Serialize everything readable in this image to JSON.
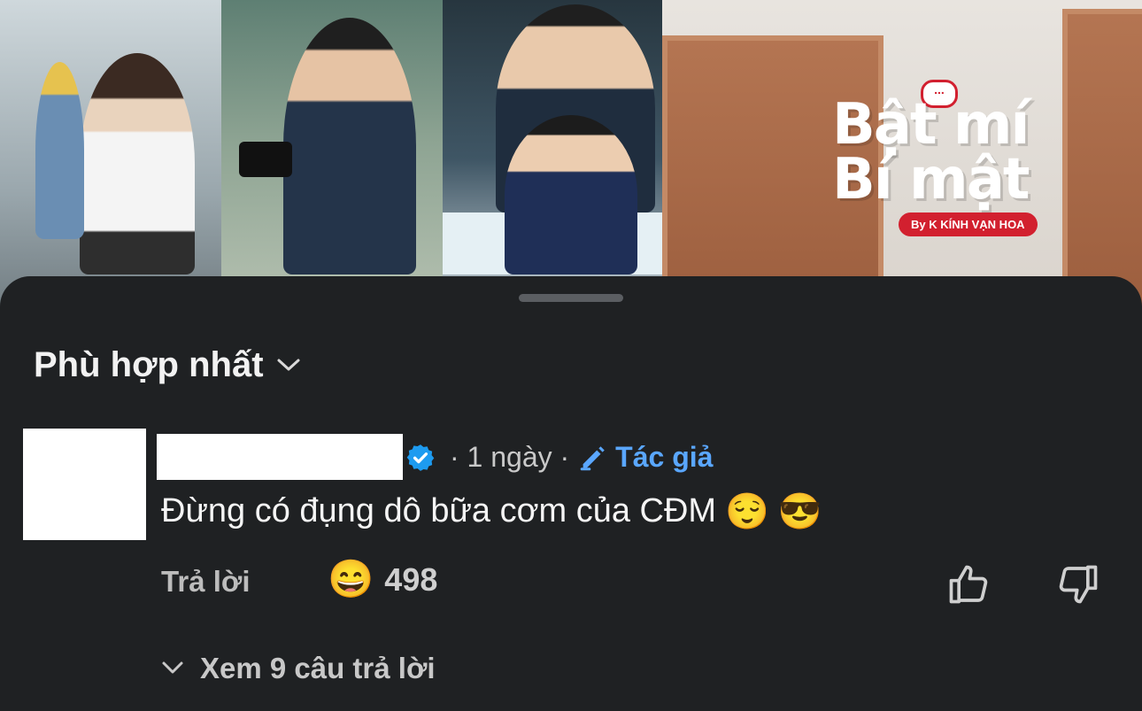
{
  "video": {
    "logo_text": "Bật mí Bí mật",
    "logo_badge": "By K KÍNH VẠN HOA",
    "logo_bubble": "..."
  },
  "sheet": {
    "sort_label": "Phù hợp nhất",
    "sort_icon": "chevron-down-icon"
  },
  "comment": {
    "time": "· 1 ngày ·",
    "author_badge": "Tác giả",
    "text": "Đừng có đụng dô bữa cơm của CĐM",
    "emojis": [
      "😌",
      "😎"
    ],
    "reply_label": "Trả lời",
    "reaction_emoji": "😄",
    "reaction_count": "498",
    "view_replies": "Xem 9 câu trả lời"
  },
  "colors": {
    "background": "#1f2123",
    "author_blue": "#5aa7ff",
    "verified_blue": "#1d9bf0"
  }
}
